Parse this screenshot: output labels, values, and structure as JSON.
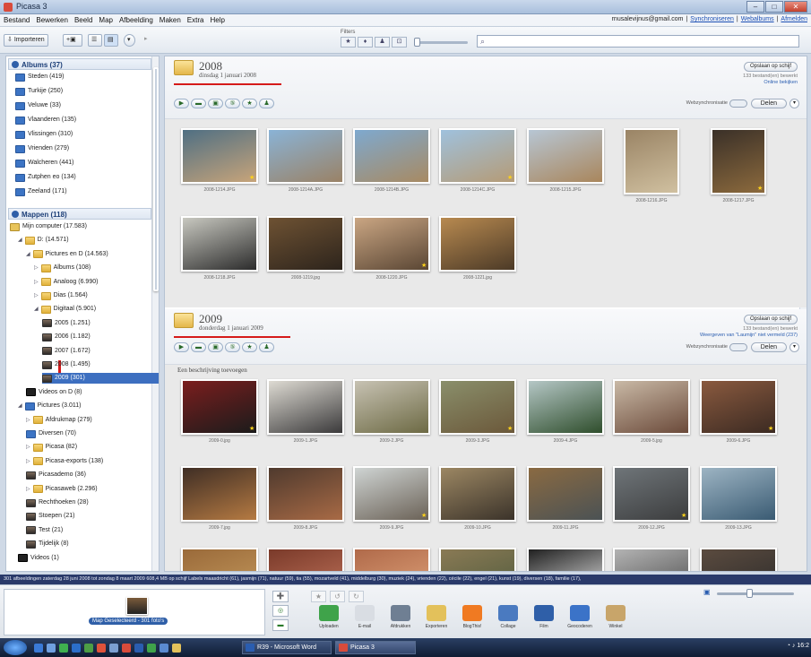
{
  "window": {
    "title": "Picasa 3",
    "buttons": [
      "‒",
      "□",
      "✕"
    ]
  },
  "menu": {
    "items": [
      "Bestand",
      "Bewerken",
      "Beeld",
      "Map",
      "Afbeelding",
      "Maken",
      "Extra",
      "Help"
    ],
    "account_email": "rnusalevijnus@gmail.com",
    "links": [
      "Synchroniseren",
      "Webalbums",
      "Afmelden"
    ],
    "separator": "|"
  },
  "toolbar": {
    "import_label": "Importeren",
    "filter_label": "Filters",
    "filter_icons": [
      "★",
      "♦",
      "♟",
      "⊡"
    ]
  },
  "sidebar": {
    "albums_header": "Albums (37)",
    "albums": [
      "Steden (419)",
      "Turkije (250)",
      "Veluwe (33)",
      "Vlaanderen (135)",
      "Vlissingen (310)",
      "Vrienden (279)",
      "Walcheren (441)",
      "Zutphen eo (134)",
      "Zeeland (171)"
    ],
    "folders_header": "Mappen (118)",
    "tree": [
      {
        "label": "Mijn computer (17.583)",
        "indent": 0,
        "icon": "pc"
      },
      {
        "label": "D: (14.571)",
        "indent": 1,
        "icon": "folder",
        "tri": "◢"
      },
      {
        "label": "Pictures en D (14.563)",
        "indent": 2,
        "icon": "folder",
        "tri": "◢"
      },
      {
        "label": "Albums (108)",
        "indent": 3,
        "icon": "folder",
        "tri": "▷"
      },
      {
        "label": "Analoog (6.990)",
        "indent": 3,
        "icon": "folder",
        "tri": "▷"
      },
      {
        "label": "Dias (1.564)",
        "indent": 3,
        "icon": "folder",
        "tri": "▷"
      },
      {
        "label": "Digitaal (5.901)",
        "indent": 3,
        "icon": "folder",
        "tri": "◢"
      },
      {
        "label": "2005 (1.251)",
        "indent": 4,
        "icon": "photo"
      },
      {
        "label": "2006 (1.182)",
        "indent": 4,
        "icon": "photo"
      },
      {
        "label": "2007 (1.672)",
        "indent": 4,
        "icon": "photo"
      },
      {
        "label": "2008 (1.495)",
        "indent": 4,
        "icon": "photo"
      },
      {
        "label": "2009 (301)",
        "indent": 4,
        "icon": "photo",
        "selected": true
      },
      {
        "label": "Videos on D (8)",
        "indent": 2,
        "icon": "video"
      },
      {
        "label": "Pictures (3.011)",
        "indent": 1,
        "icon": "album",
        "tri": "◢"
      },
      {
        "label": "Afdrukmap (279)",
        "indent": 2,
        "icon": "folder",
        "tri": "▷"
      },
      {
        "label": "Diversen (70)",
        "indent": 2,
        "icon": "album"
      },
      {
        "label": "Picasa (82)",
        "indent": 2,
        "icon": "folder",
        "tri": "▷"
      },
      {
        "label": "Picasa-exports (138)",
        "indent": 2,
        "icon": "folder",
        "tri": "▷"
      },
      {
        "label": "Picasademo (36)",
        "indent": 2,
        "icon": "photo"
      },
      {
        "label": "Picasaweb (2.296)",
        "indent": 2,
        "icon": "folder",
        "tri": "▷"
      },
      {
        "label": "Rechthoeken (28)",
        "indent": 2,
        "icon": "photo"
      },
      {
        "label": "Stoepen (21)",
        "indent": 2,
        "icon": "photo"
      },
      {
        "label": "Test (21)",
        "indent": 2,
        "icon": "photo"
      },
      {
        "label": "Tijdelijk (8)",
        "indent": 2,
        "icon": "photo"
      },
      {
        "label": "Videos (1)",
        "indent": 1,
        "icon": "video"
      }
    ]
  },
  "sections": [
    {
      "title": "2008",
      "date": "dinsdag 1 januari 2008",
      "upload_label": "Opslaan op schijf",
      "info": "133 bestand(en) bewerkt",
      "link": "Online bekijken",
      "sync_label": "Webzynchronisatie",
      "share_label": "Delen",
      "tools": [
        "▶",
        "▬",
        "▣",
        "⑤",
        "★",
        "♟"
      ],
      "rows": [
        [
          {
            "caption": "2008-1214.JPG",
            "c1": "#4f6f83",
            "c2": "#c7a47a"
          },
          {
            "caption": "2008-1214A.JPG",
            "c1": "#8ab3d6",
            "c2": "#9a8266"
          },
          {
            "caption": "2008-1214B.JPG",
            "c1": "#7ea9cf",
            "c2": "#a88a62"
          },
          {
            "caption": "2008-1214C.JPG",
            "c1": "#9fc1dd",
            "c2": "#b59b76"
          },
          {
            "caption": "2008-1215.JPG",
            "c1": "#b7c6d4",
            "c2": "#a9865c"
          },
          {
            "caption": "2008-1216.JPG",
            "c1": "#9a8465",
            "c2": "#d0c0a0"
          },
          {
            "caption": "2008-1217.JPG",
            "c1": "#3a3028",
            "c2": "#8c6a3d"
          }
        ],
        [
          {
            "caption": "2008-1218.JPG",
            "c1": "#c8c8c0",
            "c2": "#2c2c2c"
          },
          {
            "caption": "2008-1219.jpg",
            "c1": "#6e5233",
            "c2": "#2d241c"
          },
          {
            "caption": "2008-1220.JPG",
            "c1": "#caa683",
            "c2": "#5a4634"
          },
          {
            "caption": "2008-1221.jpg",
            "c1": "#b88a50",
            "c2": "#4c3a27"
          }
        ]
      ]
    },
    {
      "title": "2009",
      "date": "donderdag 1 januari 2009",
      "upload_label": "Opslaan op schijf",
      "info": "133 bestand(en) bewerkt",
      "link": "Weergeven van \"Laumijn\" niet vermeld (237)",
      "sync_label": "Webzynchronisatie",
      "share_label": "Delen",
      "tools": [
        "▶",
        "▬",
        "▣",
        "⑤",
        "★",
        "♟"
      ],
      "description": "Een beschrijving toevoegen",
      "rows": [
        [
          {
            "caption": "2009-0.jpg",
            "c1": "#7b1e1e",
            "c2": "#1b1b1b"
          },
          {
            "caption": "2009-1.JPG",
            "c1": "#dedbd3",
            "c2": "#3b3a3b"
          },
          {
            "caption": "2009-2.JPG",
            "c1": "#c7c2b3",
            "c2": "#6d6a44"
          },
          {
            "caption": "2009-3.JPG",
            "c1": "#8a8f6b",
            "c2": "#6b583a"
          },
          {
            "caption": "2009-4.JPG",
            "c1": "#b5c7c6",
            "c2": "#2f4e2c"
          },
          {
            "caption": "2009-5.jpg",
            "c1": "#c9b9a6",
            "c2": "#6b4a3a"
          },
          {
            "caption": "2009-6.JPG",
            "c1": "#8a5a3f",
            "c2": "#3b2a22"
          }
        ],
        [
          {
            "caption": "2009-7.jpg",
            "c1": "#3f2e25",
            "c2": "#b57a42"
          },
          {
            "caption": "2009-8.JPG",
            "c1": "#4f3a2e",
            "c2": "#a86a45"
          },
          {
            "caption": "2009-9.JPG",
            "c1": "#cfd4d3",
            "c2": "#6b6257"
          },
          {
            "caption": "2009-10.JPG",
            "c1": "#9c8763",
            "c2": "#3b332a"
          },
          {
            "caption": "2009-11.JPG",
            "c1": "#8a6a42",
            "c2": "#4b5254"
          },
          {
            "caption": "2009-12.JPG",
            "c1": "#6f7579",
            "c2": "#3c3d3e"
          },
          {
            "caption": "2009-13.JPG",
            "c1": "#9db4c3",
            "c2": "#3a5b73"
          }
        ],
        [
          {
            "caption": "",
            "c1": "#9a6a3a",
            "c2": "#c59a5d"
          },
          {
            "caption": "",
            "c1": "#7a3a2a",
            "c2": "#c1745b"
          },
          {
            "caption": "",
            "c1": "#b06a4a",
            "c2": "#e0a37a"
          },
          {
            "caption": "",
            "c1": "#8a7a55",
            "c2": "#4e5a3c"
          },
          {
            "caption": "",
            "c1": "#202020",
            "c2": "#eeeeee"
          },
          {
            "caption": "",
            "c1": "#b3b3b3",
            "c2": "#4a4a4a"
          },
          {
            "caption": "",
            "c1": "#5b4b3f",
            "c2": "#2a2a2a"
          }
        ]
      ]
    }
  ],
  "statusbar": {
    "text": "301 afbeeldingen   zaterdag 28 juni 2008   tot zondag 8 maart 2009   608,4 MB op schijf   Labels maasdricht (61), jasmijn (71), natuur (59), tia (55), mozartveld (41), middelburg (30), muziek (24), vrienden (22), cécile (22), engel (21), kunst (19), diversen (18), familie (17),"
  },
  "tray": {
    "selection_label": "Map Geselecteerd - 301 foto's",
    "side_icons": [
      "➕",
      "◎",
      "▬"
    ],
    "mini_icons": [
      "★",
      "↺",
      "↻"
    ],
    "actions": [
      {
        "label": "Uploaden",
        "color": "#3fa34a"
      },
      {
        "label": "E-mail",
        "color": "#d9dde3"
      },
      {
        "label": "Afdrukken",
        "color": "#6f7f93"
      },
      {
        "label": "Exporteren",
        "color": "#e3c15b"
      },
      {
        "label": "BlogThis!",
        "color": "#f07a22"
      },
      {
        "label": "Collage",
        "color": "#4a7ac0"
      },
      {
        "label": "Film",
        "color": "#2f5fa8"
      },
      {
        "label": "Geocoderen",
        "color": "#3b73c8"
      },
      {
        "label": "Winkel",
        "color": "#c8a56a"
      }
    ]
  },
  "taskbar": {
    "tasks": [
      "R39 - Microsoft Word",
      "Picasa 3"
    ],
    "clock": "16:2"
  }
}
